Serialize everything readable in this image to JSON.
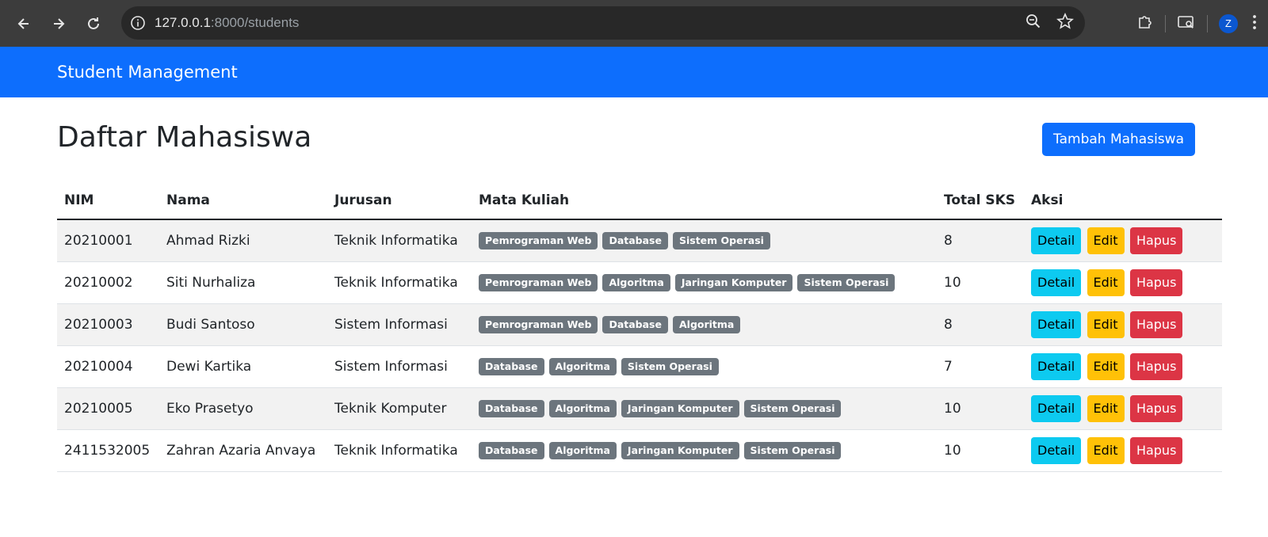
{
  "browser": {
    "url_host": "127.0.0.1",
    "url_rest": ":8000/students",
    "profile_initial": "Z"
  },
  "navbar": {
    "brand": "Student Management"
  },
  "page": {
    "title": "Daftar Mahasiswa",
    "add_button": "Tambah Mahasiswa"
  },
  "table": {
    "headers": [
      "NIM",
      "Nama",
      "Jurusan",
      "Mata Kuliah",
      "Total SKS",
      "Aksi"
    ],
    "rows": [
      {
        "nim": "20210001",
        "nama": "Ahmad Rizki",
        "jurusan": "Teknik Informatika",
        "mk": [
          "Pemrograman Web",
          "Database",
          "Sistem Operasi"
        ],
        "sks": "8"
      },
      {
        "nim": "20210002",
        "nama": "Siti Nurhaliza",
        "jurusan": "Teknik Informatika",
        "mk": [
          "Pemrograman Web",
          "Algoritma",
          "Jaringan Komputer",
          "Sistem Operasi"
        ],
        "sks": "10"
      },
      {
        "nim": "20210003",
        "nama": "Budi Santoso",
        "jurusan": "Sistem Informasi",
        "mk": [
          "Pemrograman Web",
          "Database",
          "Algoritma"
        ],
        "sks": "8"
      },
      {
        "nim": "20210004",
        "nama": "Dewi Kartika",
        "jurusan": "Sistem Informasi",
        "mk": [
          "Database",
          "Algoritma",
          "Sistem Operasi"
        ],
        "sks": "7"
      },
      {
        "nim": "20210005",
        "nama": "Eko Prasetyo",
        "jurusan": "Teknik Komputer",
        "mk": [
          "Database",
          "Algoritma",
          "Jaringan Komputer",
          "Sistem Operasi"
        ],
        "sks": "10"
      },
      {
        "nim": "2411532005",
        "nama": "Zahran Azaria Anvaya",
        "jurusan": "Teknik Informatika",
        "mk": [
          "Database",
          "Algoritma",
          "Jaringan Komputer",
          "Sistem Operasi"
        ],
        "sks": "10"
      }
    ],
    "actions": {
      "detail": "Detail",
      "edit": "Edit",
      "hapus": "Hapus"
    }
  },
  "colors": {
    "primary": "#0d6efd",
    "info": "#0dcaf0",
    "warning": "#ffc107",
    "danger": "#dc3545",
    "badge": "#6c757d"
  }
}
